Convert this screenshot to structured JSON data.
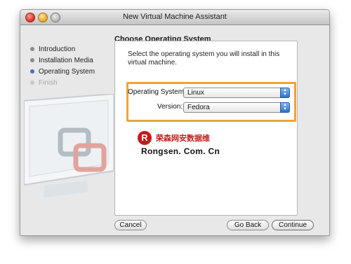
{
  "window": {
    "title": "New Virtual Machine Assistant"
  },
  "sidebar": {
    "steps": [
      {
        "label": "Introduction",
        "state": "done"
      },
      {
        "label": "Installation Media",
        "state": "done"
      },
      {
        "label": "Operating System",
        "state": "current"
      },
      {
        "label": "Finish",
        "state": "disabled"
      }
    ]
  },
  "main": {
    "section_title": "Choose Operating System",
    "instructions": "Select the operating system you will install in this virtual machine.",
    "os_label": "Operating System:",
    "os_value": "Linux",
    "version_label": "Version:",
    "version_value": "Fedora"
  },
  "watermark": {
    "logo_letter": "R",
    "chinese_text": "荣森网安数据维",
    "english_text": "Rongsen. Com. Cn"
  },
  "buttons": {
    "cancel": "Cancel",
    "back": "Go Back",
    "continue": "Continue"
  },
  "colors": {
    "highlight": "#f0a23a",
    "watermark_red": "#c21d1d",
    "current_step": "#4a72b8"
  }
}
